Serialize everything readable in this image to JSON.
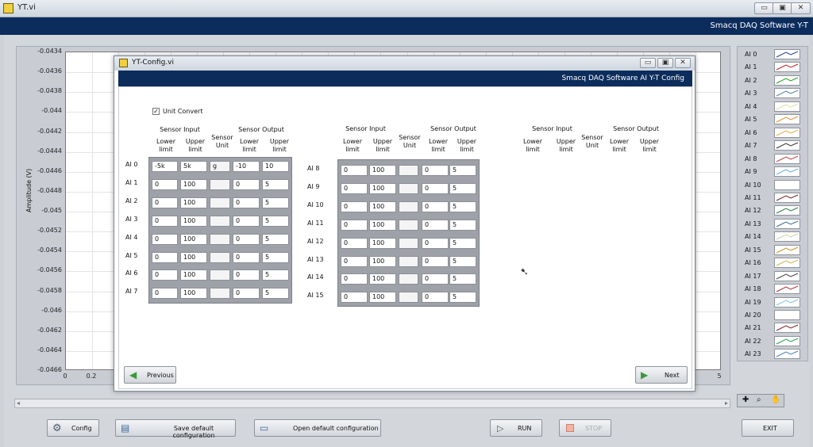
{
  "main_window": {
    "title": "YT.vi",
    "banner": "Smacq DAQ Software Y-T",
    "controls": {
      "minimize": "▭",
      "maximize": "▣",
      "close": "✕"
    }
  },
  "graph": {
    "ylabel": "Amplitude (V)",
    "yticks": [
      "-0.0434",
      "-0.0436",
      "-0.0438",
      "-0.044",
      "-0.0442",
      "-0.0444",
      "-0.0446",
      "-0.0448",
      "-0.045",
      "-0.0452",
      "-0.0454",
      "-0.0456",
      "-0.0458",
      "-0.046",
      "-0.0462",
      "-0.0464",
      "-0.0466"
    ],
    "xticks": [
      "0",
      "0.2",
      "5"
    ],
    "ylim": [
      -0.0466,
      -0.0434
    ],
    "xlim": [
      0,
      5
    ],
    "grid": true
  },
  "legend": {
    "items": [
      {
        "label": "AI 0",
        "color": "#1f3f8f"
      },
      {
        "label": "AI 1",
        "color": "#c02020"
      },
      {
        "label": "AI 2",
        "color": "#20a020"
      },
      {
        "label": "AI 3",
        "color": "#5080b0"
      },
      {
        "label": "AI 4",
        "color": "#e0e0a0"
      },
      {
        "label": "AI 5",
        "color": "#e09030"
      },
      {
        "label": "AI 6",
        "color": "#e0b040"
      },
      {
        "label": "AI 7",
        "color": "#303030"
      },
      {
        "label": "AI 8",
        "color": "#c04040"
      },
      {
        "label": "AI 9",
        "color": "#60b0e0"
      },
      {
        "label": "AI 10",
        "color": "#ffffff"
      },
      {
        "label": "AI 11",
        "color": "#7a2020"
      },
      {
        "label": "AI 12",
        "color": "#208040"
      },
      {
        "label": "AI 13",
        "color": "#3070a0"
      },
      {
        "label": "AI 14",
        "color": "#d0d0a0"
      },
      {
        "label": "AI 15",
        "color": "#d09020"
      },
      {
        "label": "AI 16",
        "color": "#d0b050"
      },
      {
        "label": "AI 17",
        "color": "#404040"
      },
      {
        "label": "AI 18",
        "color": "#b03030"
      },
      {
        "label": "AI 19",
        "color": "#80c0e0"
      },
      {
        "label": "AI 20",
        "color": "#ffffff"
      },
      {
        "label": "AI 21",
        "color": "#802020"
      },
      {
        "label": "AI 22",
        "color": "#20a050"
      },
      {
        "label": "AI 23",
        "color": "#4080c0"
      }
    ]
  },
  "bottom_bar": {
    "config": "Config",
    "save_default": "Save default configuration",
    "open_default": "Open default configuration",
    "run": "RUN",
    "stop": "STOP",
    "exit": "EXIT"
  },
  "dialog": {
    "title": "YT-Config.vi",
    "banner": "Smacq DAQ Software AI Y-T Config",
    "unit_convert_label": "Unit Convert",
    "unit_convert_checked": true,
    "headers": {
      "sensor_input": "Sensor Input",
      "sensor_output": "Sensor Output",
      "lower_limit": "Lower limit",
      "upper_limit": "Upper limit",
      "sensor_unit": "Sensor Unit"
    },
    "group1": [
      {
        "label": "AI 0",
        "in_lower": "-5k",
        "in_upper": "5k",
        "unit": "g",
        "out_lower": "-10",
        "out_upper": "10"
      },
      {
        "label": "AI 1",
        "in_lower": "0",
        "in_upper": "100",
        "unit": "",
        "out_lower": "0",
        "out_upper": "5"
      },
      {
        "label": "AI 2",
        "in_lower": "0",
        "in_upper": "100",
        "unit": "",
        "out_lower": "0",
        "out_upper": "5"
      },
      {
        "label": "AI 3",
        "in_lower": "0",
        "in_upper": "100",
        "unit": "",
        "out_lower": "0",
        "out_upper": "5"
      },
      {
        "label": "AI 4",
        "in_lower": "0",
        "in_upper": "100",
        "unit": "",
        "out_lower": "0",
        "out_upper": "5"
      },
      {
        "label": "AI 5",
        "in_lower": "0",
        "in_upper": "100",
        "unit": "",
        "out_lower": "0",
        "out_upper": "5"
      },
      {
        "label": "AI 6",
        "in_lower": "0",
        "in_upper": "100",
        "unit": "",
        "out_lower": "0",
        "out_upper": "5"
      },
      {
        "label": "AI 7",
        "in_lower": "0",
        "in_upper": "100",
        "unit": "",
        "out_lower": "0",
        "out_upper": "5"
      }
    ],
    "group2": [
      {
        "label": "AI 8",
        "in_lower": "0",
        "in_upper": "100",
        "unit": "",
        "out_lower": "0",
        "out_upper": "5"
      },
      {
        "label": "AI 9",
        "in_lower": "0",
        "in_upper": "100",
        "unit": "",
        "out_lower": "0",
        "out_upper": "5"
      },
      {
        "label": "AI 10",
        "in_lower": "0",
        "in_upper": "100",
        "unit": "",
        "out_lower": "0",
        "out_upper": "5"
      },
      {
        "label": "AI 11",
        "in_lower": "0",
        "in_upper": "100",
        "unit": "",
        "out_lower": "0",
        "out_upper": "5"
      },
      {
        "label": "AI 12",
        "in_lower": "0",
        "in_upper": "100",
        "unit": "",
        "out_lower": "0",
        "out_upper": "5"
      },
      {
        "label": "AI 13",
        "in_lower": "0",
        "in_upper": "100",
        "unit": "",
        "out_lower": "0",
        "out_upper": "5"
      },
      {
        "label": "AI 14",
        "in_lower": "0",
        "in_upper": "100",
        "unit": "",
        "out_lower": "0",
        "out_upper": "5"
      },
      {
        "label": "AI 15",
        "in_lower": "0",
        "in_upper": "100",
        "unit": "",
        "out_lower": "0",
        "out_upper": "5"
      }
    ],
    "previous": "Previous",
    "next": "Next"
  }
}
